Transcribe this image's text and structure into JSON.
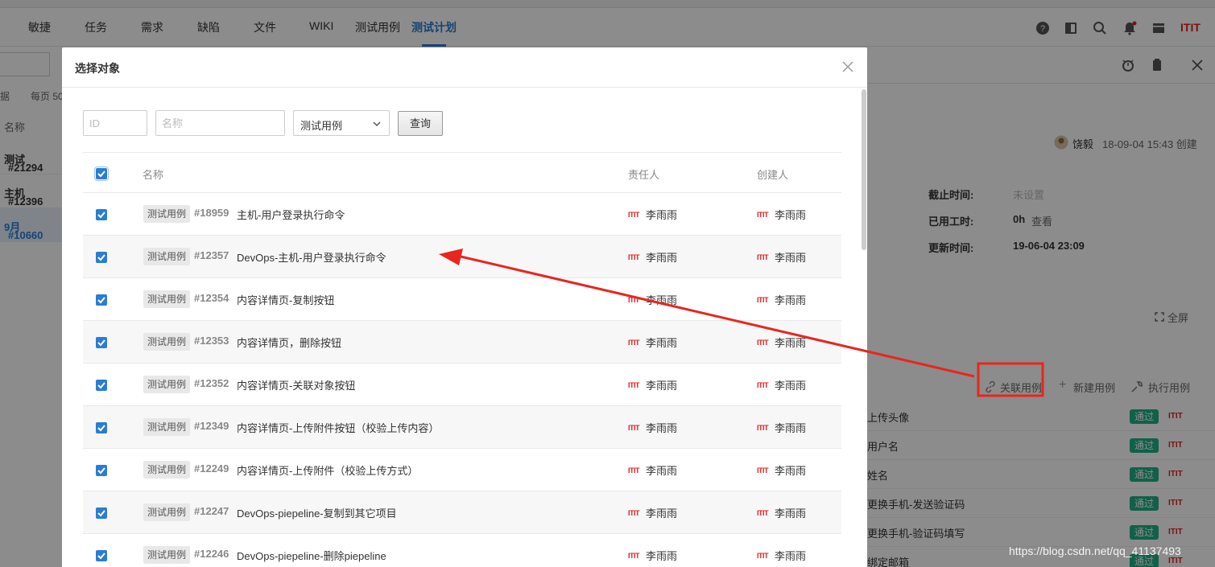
{
  "nav": {
    "items": [
      "敏捷",
      "任务",
      "需求",
      "缺陷",
      "文件",
      "WIKI",
      "测试用例",
      "测试计划"
    ],
    "active": "测试计划",
    "brand": "ITIT"
  },
  "left_panel": {
    "count_prefix": "据",
    "per_page": "每页 50",
    "col_name": "名称",
    "rows": [
      {
        "id": "#21294",
        "text": "测试"
      },
      {
        "id": "#12396",
        "text": "主机"
      },
      {
        "id": "#10660",
        "text": "9月"
      }
    ]
  },
  "right_panel": {
    "author": "饶毅",
    "created": "18-09-04 15:43 创建",
    "fields": [
      {
        "label": "截止时间:",
        "value": "未设置"
      },
      {
        "label": "已用工时:",
        "value": "0h",
        "extra": "查看"
      },
      {
        "label": "更新时间:",
        "value": "19-06-04 23:09"
      }
    ],
    "fullscreen": "全屏",
    "actions": {
      "link": "关联用例",
      "new": "新建用例",
      "run": "执行用例"
    },
    "list": [
      {
        "text": "上传头像",
        "badge": "通过",
        "brand": "ITIT"
      },
      {
        "text": "用户名",
        "badge": "通过",
        "brand": "ITIT"
      },
      {
        "text": "姓名",
        "badge": "通过",
        "brand": "ITIT"
      },
      {
        "text": "更换手机-发送验证码",
        "badge": "通过",
        "brand": "ITIT"
      },
      {
        "text": "更换手机-验证码填写",
        "badge": "通过",
        "brand": "ITIT"
      },
      {
        "text": "绑定邮箱",
        "badge": "通过",
        "brand": "ITIT"
      }
    ]
  },
  "modal": {
    "title": "选择对象",
    "filters": {
      "id_placeholder": "ID",
      "name_placeholder": "名称",
      "type_selected": "测试用例",
      "query_label": "查询"
    },
    "columns": {
      "name": "名称",
      "assignee": "责任人",
      "creator": "创建人"
    },
    "rows": [
      {
        "tag": "测试用例",
        "id": "#18959",
        "name": "主机-用户登录执行命令",
        "assignee_brand": "ITIT",
        "assignee": "李雨雨",
        "creator_brand": "ITIT",
        "creator": "李雨雨",
        "checked": true
      },
      {
        "tag": "测试用例",
        "id": "#12357",
        "name": "DevOps-主机-用户登录执行命令",
        "assignee_brand": "ITIT",
        "assignee": "李雨雨",
        "creator_brand": "ITIT",
        "creator": "李雨雨",
        "checked": true
      },
      {
        "tag": "测试用例",
        "id": "#12354",
        "name": "内容详情页-复制按钮",
        "assignee_brand": "ITIT",
        "assignee": "李雨雨",
        "creator_brand": "ITIT",
        "creator": "李雨雨",
        "checked": true
      },
      {
        "tag": "测试用例",
        "id": "#12353",
        "name": "内容详情页，删除按钮",
        "assignee_brand": "ITIT",
        "assignee": "李雨雨",
        "creator_brand": "ITIT",
        "creator": "李雨雨",
        "checked": true
      },
      {
        "tag": "测试用例",
        "id": "#12352",
        "name": "内容详情页-关联对象按钮",
        "assignee_brand": "ITIT",
        "assignee": "李雨雨",
        "creator_brand": "ITIT",
        "creator": "李雨雨",
        "checked": true
      },
      {
        "tag": "测试用例",
        "id": "#12349",
        "name": "内容详情页-上传附件按钮（校验上传内容）",
        "assignee_brand": "ITIT",
        "assignee": "李雨雨",
        "creator_brand": "ITIT",
        "creator": "李雨雨",
        "checked": true
      },
      {
        "tag": "测试用例",
        "id": "#12249",
        "name": "内容详情页-上传附件（校验上传方式）",
        "assignee_brand": "ITIT",
        "assignee": "李雨雨",
        "creator_brand": "ITIT",
        "creator": "李雨雨",
        "checked": true
      },
      {
        "tag": "测试用例",
        "id": "#12247",
        "name": "DevOps-piepeline-复制到其它项目",
        "assignee_brand": "ITIT",
        "assignee": "李雨雨",
        "creator_brand": "ITIT",
        "creator": "李雨雨",
        "checked": true
      },
      {
        "tag": "测试用例",
        "id": "#12246",
        "name": "DevOps-piepeline-删除piepeline",
        "assignee_brand": "ITIT",
        "assignee": "李雨雨",
        "creator_brand": "ITIT",
        "creator": "李雨雨",
        "checked": true
      }
    ]
  },
  "annotation": {
    "color": "#e8261e"
  },
  "watermark": "https://blog.csdn.net/qq_41137493"
}
